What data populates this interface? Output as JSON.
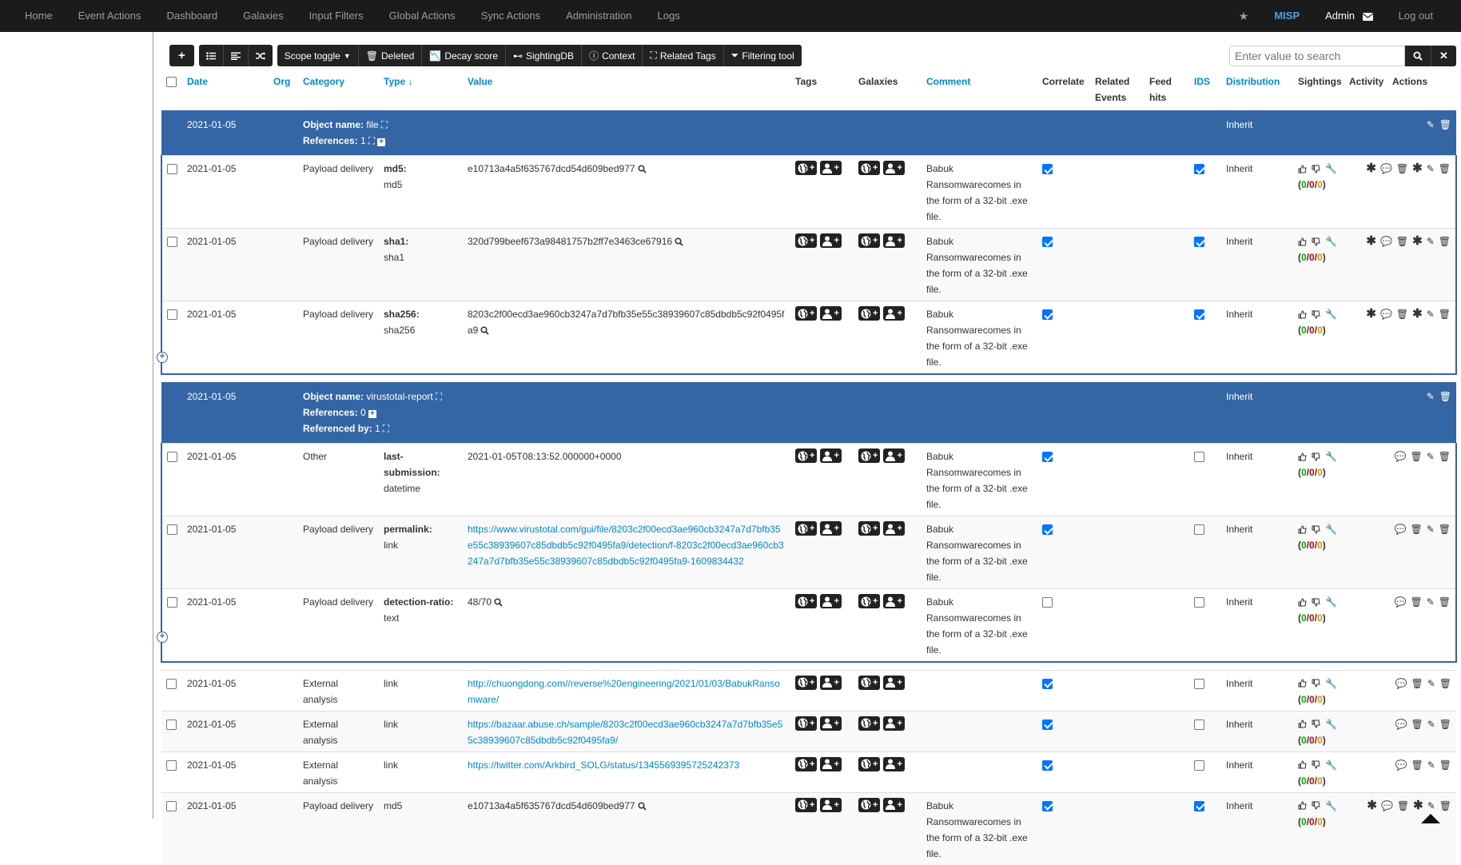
{
  "nav": {
    "items": [
      "Home",
      "Event Actions",
      "Dashboard",
      "Galaxies",
      "Input Filters",
      "Global Actions",
      "Sync Actions",
      "Administration",
      "Logs"
    ],
    "brand": "MISP",
    "user": "Admin",
    "logout": "Log out"
  },
  "toolbar": {
    "scope_toggle": "Scope toggle",
    "deleted": "Deleted",
    "decay_score": "Decay score",
    "sightingdb": "SightingDB",
    "context": "Context",
    "related_tags": "Related Tags",
    "filtering_tool": "Filtering tool"
  },
  "search": {
    "placeholder": "Enter value to search"
  },
  "columns": {
    "date": "Date",
    "org": "Org",
    "category": "Category",
    "type": "Type",
    "value": "Value",
    "tags": "Tags",
    "galaxies": "Galaxies",
    "comment": "Comment",
    "correlate": "Correlate",
    "related_events": "Related Events",
    "feed_hits": "Feed hits",
    "ids": "IDS",
    "distribution": "Distribution",
    "sightings": "Sightings",
    "activity": "Activity",
    "actions": "Actions"
  },
  "labels": {
    "object_name": "Object name:",
    "references": "References:",
    "referenced_by": "Referenced by:"
  },
  "objects": [
    {
      "date": "2021-01-05",
      "name": "file",
      "references": "1",
      "distribution": "Inherit",
      "attributes": [
        {
          "date": "2021-01-05",
          "category": "Payload delivery",
          "relation": "md5:",
          "type": "md5",
          "value": "e10713a4a5f635767dcd54d609bed977",
          "is_link": false,
          "comment": "Babuk Ransomwarecomes in the form of a 32-bit .exe file.",
          "correlate": true,
          "ids": true,
          "distribution": "Inherit",
          "extra_actions": true
        },
        {
          "date": "2021-01-05",
          "category": "Payload delivery",
          "relation": "sha1:",
          "type": "sha1",
          "value": "320d799beef673a98481757b2ff7e3463ce67916",
          "is_link": false,
          "comment": "Babuk Ransomwarecomes in the form of a 32-bit .exe file.",
          "correlate": true,
          "ids": true,
          "distribution": "Inherit",
          "extra_actions": true
        },
        {
          "date": "2021-01-05",
          "category": "Payload delivery",
          "relation": "sha256:",
          "type": "sha256",
          "value": "8203c2f00ecd3ae960cb3247a7d7bfb35e55c38939607c85dbdb5c92f0495fa9",
          "is_link": false,
          "comment": "Babuk Ransomwarecomes in the form of a 32-bit .exe file.",
          "correlate": true,
          "ids": true,
          "distribution": "Inherit",
          "extra_actions": true
        }
      ]
    },
    {
      "date": "2021-01-05",
      "name": "virustotal-report",
      "references": "0",
      "referenced_by": "1",
      "distribution": "Inherit",
      "attributes": [
        {
          "date": "2021-01-05",
          "category": "Other",
          "relation": "last-submission:",
          "type": "datetime",
          "value": "2021-01-05T08:13:52.000000+0000",
          "is_link": false,
          "comment": "Babuk Ransomwarecomes in the form of a 32-bit .exe file.",
          "correlate": true,
          "ids": false,
          "distribution": "Inherit",
          "extra_actions": false
        },
        {
          "date": "2021-01-05",
          "category": "Payload delivery",
          "relation": "permalink:",
          "type": "link",
          "value": "https://www.virustotal.com/gui/file/8203c2f00ecd3ae960cb3247a7d7bfb35e55c38939607c85dbdb5c92f0495fa9/detection/f-8203c2f00ecd3ae960cb3247a7d7bfb35e55c38939607c85dbdb5c92f0495fa9-1609834432",
          "is_link": true,
          "comment": "Babuk Ransomwarecomes in the form of a 32-bit .exe file.",
          "correlate": true,
          "ids": false,
          "distribution": "Inherit",
          "extra_actions": false
        },
        {
          "date": "2021-01-05",
          "category": "Payload delivery",
          "relation": "detection-ratio:",
          "type": "text",
          "value": "48/70",
          "is_link": false,
          "comment": "Babuk Ransomwarecomes in the form of a 32-bit .exe file.",
          "correlate": false,
          "ids": false,
          "distribution": "Inherit",
          "extra_actions": false
        }
      ]
    }
  ],
  "attributes": [
    {
      "date": "2021-01-05",
      "category": "External analysis",
      "type": "link",
      "value": "http://chuongdong.com//reverse%20engineering/2021/01/03/BabukRansomware/",
      "is_link": true,
      "comment": "",
      "correlate": true,
      "ids": false,
      "distribution": "Inherit",
      "extra_actions": false
    },
    {
      "date": "2021-01-05",
      "category": "External analysis",
      "type": "link",
      "value": "https://bazaar.abuse.ch/sample/8203c2f00ecd3ae960cb3247a7d7bfb35e55c38939607c85dbdb5c92f0495fa9/",
      "is_link": true,
      "comment": "",
      "correlate": true,
      "ids": false,
      "distribution": "Inherit",
      "extra_actions": false
    },
    {
      "date": "2021-01-05",
      "category": "External analysis",
      "type": "link",
      "value": "https://twitter.com/Arkbird_SOLG/status/1345569395725242373",
      "is_link": true,
      "comment": "",
      "correlate": true,
      "ids": false,
      "distribution": "Inherit",
      "extra_actions": false
    },
    {
      "date": "2021-01-05",
      "category": "Payload delivery",
      "type": "md5",
      "value": "e10713a4a5f635767dcd54d609bed977",
      "is_link": false,
      "comment": "Babuk Ransomwarecomes in the form of a 32-bit .exe file.",
      "correlate": true,
      "ids": true,
      "distribution": "Inherit",
      "extra_actions": true
    }
  ],
  "sightings": {
    "positive": "0",
    "negative": "0",
    "expired": "0",
    "separator": "/"
  },
  "colors": {
    "object_header": "#3465a4",
    "link": "#0088cc",
    "nav_bg": "#1b1b1b",
    "brand": "#4aa0e6"
  }
}
